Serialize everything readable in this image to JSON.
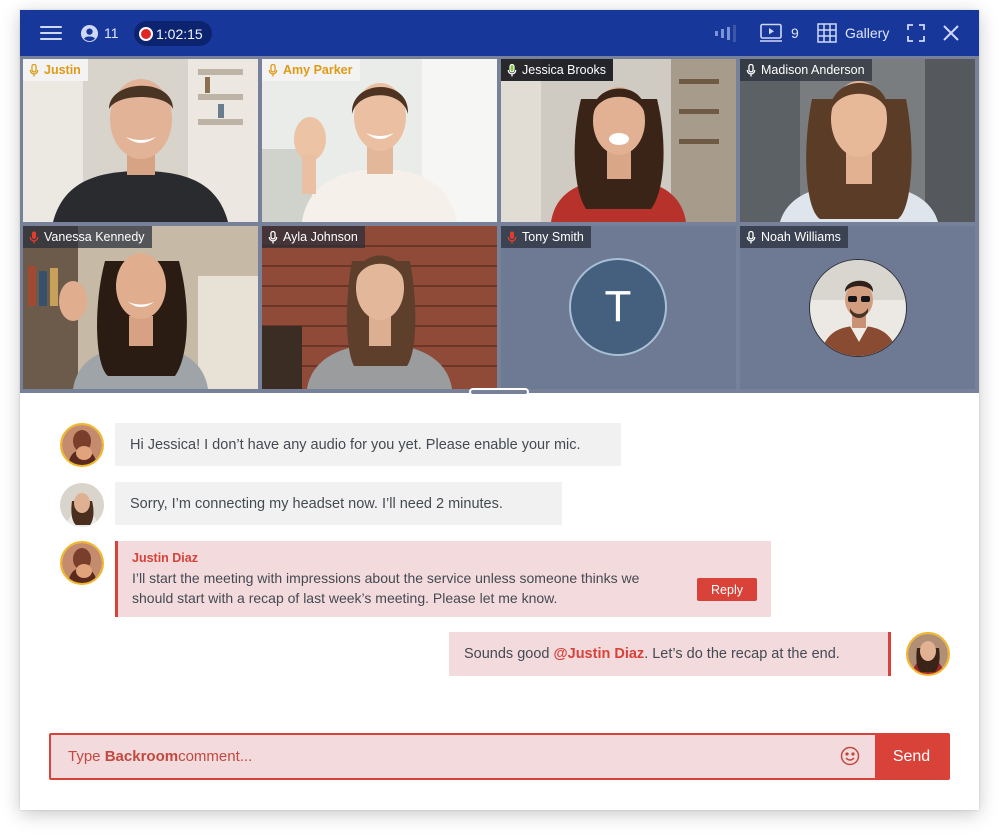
{
  "topbar": {
    "participant_count": "11",
    "record_time": "1:02:15",
    "stream_count": "9",
    "view_label": "Gallery"
  },
  "tiles": [
    {
      "name": "Justin",
      "mic": "active-amber",
      "style": "light"
    },
    {
      "name": "Amy Parker",
      "mic": "active-amber",
      "style": "light"
    },
    {
      "name": "Jessica Brooks",
      "mic": "speaking-green",
      "style": "dark",
      "active": true
    },
    {
      "name": "Madison Anderson",
      "mic": "on",
      "style": "dark"
    },
    {
      "name": "Vanessa Kennedy",
      "mic": "muted-red",
      "style": "dark"
    },
    {
      "name": "Ayla Johnson",
      "mic": "on",
      "style": "dark"
    },
    {
      "name": "Tony Smith",
      "mic": "muted-red",
      "style": "dark",
      "initial": "T"
    },
    {
      "name": "Noah Williams",
      "mic": "on",
      "style": "dark"
    }
  ],
  "chat": {
    "messages": [
      {
        "text": "Hi Jessica! I don’t have any audio for you yet. Please enable your mic."
      },
      {
        "text": "Sorry, I’m connecting my headset now. I’ll need 2 minutes."
      },
      {
        "author": "Justin Diaz",
        "text": "I’ll start the meeting with impressions about the service unless someone thinks we should start with a recap of last week’s meeting. Please let me know.",
        "reply_label": "Reply"
      },
      {
        "prefix": "Sounds good ",
        "mention": "@Justin Diaz",
        "suffix": ". Let’s do the recap at the end."
      }
    ]
  },
  "composer": {
    "placeholder_prefix": "Type ",
    "placeholder_bold": "Backroom",
    "placeholder_suffix": " comment...",
    "send_label": "Send"
  },
  "colors": {
    "topbar": "#17379a",
    "accent": "#d84238",
    "highlight_bg": "#f3dadd",
    "grid_bg": "#77819a",
    "ring": "#f1b729"
  }
}
